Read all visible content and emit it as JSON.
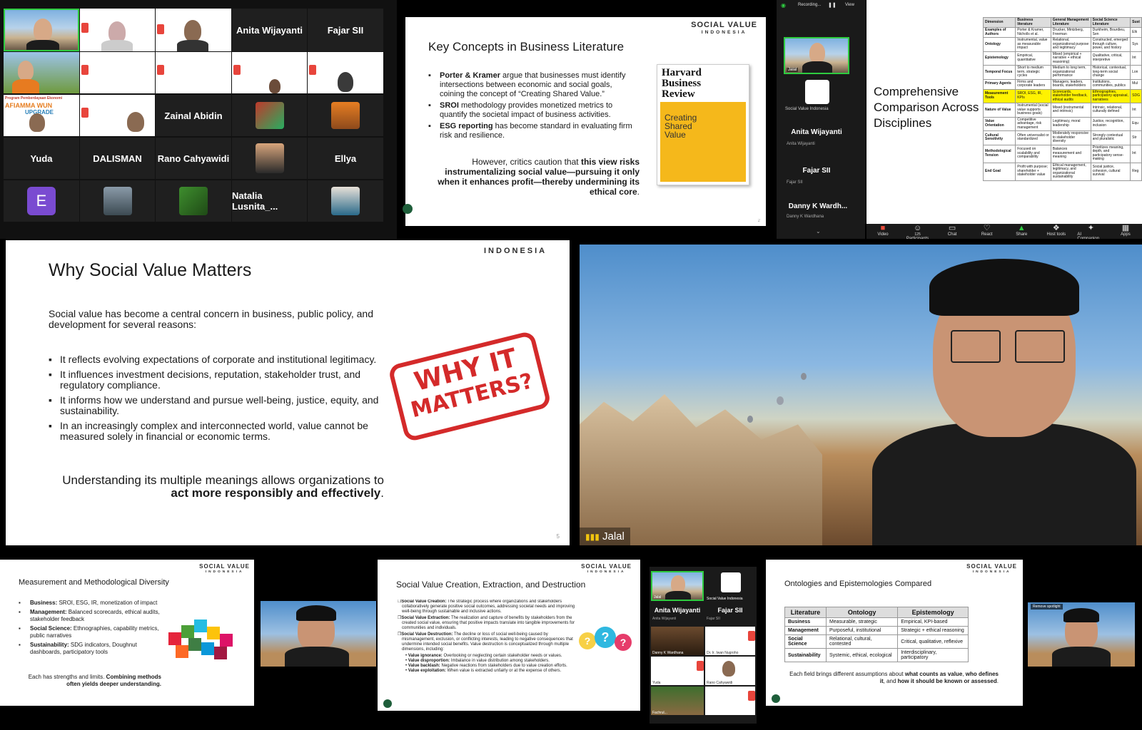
{
  "gallery": {
    "names": {
      "anita": "Anita Wijayanti",
      "fajar": "Fajar SII",
      "zainal": "Zainal Abidin",
      "yuda": "Yuda",
      "dalisman": "DALISMAN",
      "rano": "Rano Cahyawidi",
      "ellya": "Ellya",
      "natalia": "Natalia  Lusnita_...",
      "avatar_letter": "E"
    },
    "banner_text": "Program Pemberdayaan Ekonomi",
    "banner_text2": "AFIAMMA WUN",
    "banner_text3": "UPGRADE"
  },
  "slide_key": {
    "logo1": "SOCIAL VALUE",
    "logo2": "INDONESIA",
    "title": "Key Concepts in Business Literature",
    "b1_bold": "Porter & Kramer",
    "b1_rest": " argue that businesses must identify intersections between economic and social goals, coining the concept of “Creating Shared Value.”",
    "b2_bold": "SROI",
    "b2_rest": " methodology provides monetized metrics to quantify the societal impact of business activities.",
    "b3_bold": "ESG reporting",
    "b3_rest": " has become standard in evaluating firm risk and resilience.",
    "quote_pre": "However, critics caution that ",
    "quote_bold": "this view risks instrumentalizing social value—pursuing it only when it enhances profit—thereby undermining its ethical core",
    "quote_end": ".",
    "hbr_title": "Harvard Business Review",
    "hbr_sub": "Creating Shared Value",
    "page_num": "2"
  },
  "zoom_strip": {
    "status_text": "Recording...",
    "view_label": "View",
    "jalal_label": "Jalal",
    "svi_label": "Social Value Indonesia",
    "anita_name": "Anita Wijayanti",
    "anita_small": "Anita Wijayanti",
    "fajar_name": "Fajar SII",
    "fajar_small": "Fajar SII",
    "danny_name": "Danny K Wardh...",
    "danny_small": "Danny K Wardhana"
  },
  "comparison": {
    "title": "Comprehensive Comparison Across Disciplines",
    "headers": [
      "Dimension",
      "Business literature",
      "General Management Literature",
      "Social Science Literature",
      "Sust"
    ],
    "rows": [
      [
        "Examples of Authors",
        "Porter & Kramer, Nicholls et al.",
        "Drucker, Mintzberg, Freeman",
        "Durkheim, Bourdieu, Sen",
        "Elk"
      ],
      [
        "Ontology",
        "Instrumental, value as measurable impact",
        "Relational, organizational purpose and legitimacy",
        "Constructed, emerged through culture, power, and history",
        "Sys"
      ],
      [
        "Epistemology",
        "Empirical, quantitative",
        "Mixed (empirical + narrative + ethical reasoning)",
        "Qualitative, critical, interpretive",
        "Int"
      ],
      [
        "Temporal Focus",
        "Short to medium term, strategic cycles",
        "Medium to long term, organizational performance",
        "Historical, contextual, long-term social change",
        "Lon"
      ],
      [
        "Primary Agents",
        "Firms and corporate leaders",
        "Managers, leaders, boards, stakeholders",
        "Institutions, communities, publics",
        "Mul"
      ],
      [
        "Measurement Tools",
        "SROI, ESG, IR, KPIs",
        "Scorecards, stakeholder feedback, ethical audits",
        "Ethnographies, participatory appraisal, narratives",
        "SDG"
      ],
      [
        "Nature of Value",
        "Instrumental (social value supports business goals)",
        "Mixed (instrumental and intrinsic)",
        "Intrinsic, relational, culturally defined",
        "Int"
      ],
      [
        "Value Orientation",
        "Competitive advantage, risk management",
        "Legitimacy, moral leadership",
        "Justice, recognition, inclusion",
        "Equ"
      ],
      [
        "Cultural Sensitivity",
        "Often universalist or standardized",
        "Moderately responsive to stakeholder diversity",
        "Strongly contextual and pluralistic",
        "Str"
      ],
      [
        "Methodological Tension",
        "Focused on scalability and comparability",
        "Balances measurement and meaning",
        "Prioritizes meaning, depth, and participatory sense-making",
        "Int"
      ],
      [
        "End Goal",
        "Profit with purpose; shareholder + stakeholder value",
        "Ethical management, legitimacy, and organizational sustainability",
        "Social justice, cohesion, cultural survival",
        "Reg"
      ]
    ],
    "highlight_row": 5,
    "toolbar": [
      {
        "icon": "video-icon",
        "glyph": "■",
        "label": "Video"
      },
      {
        "icon": "participants-icon",
        "glyph": "☺",
        "label": "Participants"
      },
      {
        "icon": "chat-icon",
        "glyph": "▭",
        "label": "Chat"
      },
      {
        "icon": "react-icon",
        "glyph": "♡",
        "label": "React"
      },
      {
        "icon": "share-icon",
        "glyph": "▲",
        "label": "Share"
      },
      {
        "icon": "host-tools-icon",
        "glyph": "❖",
        "label": "Host tools"
      },
      {
        "icon": "ai-companion-icon",
        "glyph": "✦",
        "label": "AI Companion"
      },
      {
        "icon": "apps-icon",
        "glyph": "▦",
        "label": "Apps"
      }
    ],
    "participant_count": "125"
  },
  "slide_why": {
    "logo2": "INDONESIA",
    "title": "Why Social Value Matters",
    "intro": "Social value has become a central concern in business, public policy, and development for several reasons:",
    "bullets": [
      "It reflects evolving expectations of corporate and institutional legitimacy.",
      "It influences investment decisions, reputation, stakeholder trust, and regulatory compliance.",
      "It informs how we understand and pursue well-being, justice, equity, and sustainability.",
      "In an increasingly complex and interconnected world, value cannot be measured solely in financial or economic terms."
    ],
    "closing_pre": "Understanding its multiple meanings allows organizations to ",
    "closing_bold": "act more responsibly and effectively",
    "closing_end": ".",
    "stamp1": "WHY IT",
    "stamp2": "MATTERS?",
    "page_num": "5"
  },
  "main_video": {
    "speaker": "Jalal"
  },
  "slide_measure": {
    "logo1": "SOCIAL VALUE",
    "logo2": "INDONESIA",
    "title": "Measurement and Methodological Diversity",
    "items": [
      {
        "bold": "Business:",
        "rest": " SROI, ESG, IR, monetization of impact"
      },
      {
        "bold": "Management:",
        "rest": " Balanced scorecards, ethical audits, stakeholder feedback"
      },
      {
        "bold": "Social Science:",
        "rest": " Ethnographies, capability metrics, public narratives"
      },
      {
        "bold": "Sustainability:",
        "rest": " SDG indicators, Doughnut dashboards, participatory tools"
      }
    ],
    "closing_pre": "Each has strengths and limits. ",
    "closing_bold": "Combining methods often yields deeper understanding."
  },
  "slide_creation": {
    "logo1": "SOCIAL VALUE",
    "logo2": "INDONESIA",
    "title": "Social Value Creation, Extraction, and Destruction",
    "items": [
      {
        "bold": "Social Value Creation:",
        "rest": " The strategic process where organizations and stakeholders collaboratively generate positive social outcomes, addressing societal needs and improving well-being through sustainable and inclusive actions."
      },
      {
        "bold": "Social Value Extraction:",
        "rest": " The realization and capture of benefits by stakeholders from the created social value, ensuring that positive impacts translate into tangible improvements for communities and individuals."
      },
      {
        "bold": "Social Value Destruction:",
        "rest": " The decline or loss of social well-being caused by mismanagement, exclusion, or conflicting interests, leading to negative consequences that undermine intended social benefits. Value destruction is conceptualized through multiple dimensions, including:"
      }
    ],
    "sub_items": [
      {
        "bold": "Value ignorance:",
        "rest": " Overlooking or neglecting certain stakeholder needs or values."
      },
      {
        "bold": "Value disproportion:",
        "rest": " Imbalance in value distribution among stakeholders."
      },
      {
        "bold": "Value backlash:",
        "rest": " Negative reactions from stakeholders due to value creation efforts."
      },
      {
        "bold": "Value exploitation:",
        "rest": " When value is extracted unfairly or at the expense of others."
      }
    ]
  },
  "mini_panel": {
    "jalal": "Jalal",
    "svi": "Social Value Indonesia",
    "anita": "Anita Wijayanti",
    "anita_small": "Anita Wijayanti",
    "fajar": "Fajar SII",
    "fajar_small": "Fajar SII",
    "danny_small": "Danny K Wardhana",
    "dr_label": "Dr. Ir. Iwan Nugroho",
    "yuda_small": "Yuda",
    "rano_small": "Rano Cahyawidi",
    "fachrul": "Fachrul..."
  },
  "slide_onto": {
    "logo1": "SOCIAL VALUE",
    "logo2": "INDONESIA",
    "title": "Ontologies and Epistemologies Compared",
    "headers": [
      "Literature",
      "Ontology",
      "Epistemology"
    ],
    "rows": [
      [
        "Business",
        "Measurable, strategic",
        "Empirical, KPI-based"
      ],
      [
        "Management",
        "Purposeful, institutional",
        "Strategic + ethical reasoning"
      ],
      [
        "Social Science",
        "Relational, cultural, contested",
        "Critical, qualitative, reflexive"
      ],
      [
        "Sustainability",
        "Systemic, ethical, ecological",
        "Interdisciplinary, participatory"
      ]
    ],
    "closing_pre": "Each field brings different assumptions about ",
    "closing_bold1": "what counts as value",
    "closing_mid": ", ",
    "closing_bold2": "who defines it",
    "closing_mid2": ", and ",
    "closing_bold3": "how it should be known or assessed",
    "closing_end": "."
  },
  "side_video": {
    "spotlight_label": "Remove spotlight"
  },
  "colors": {
    "zoom_green": "#2ecc40",
    "hbr_yellow": "#f5b81b",
    "stamp_red": "#d42a2a",
    "highlight_yellow": "#fff200"
  }
}
